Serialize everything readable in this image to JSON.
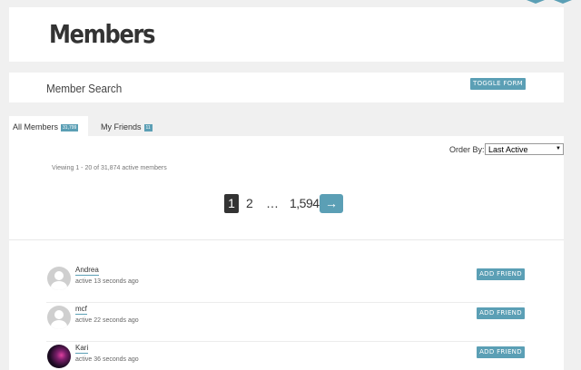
{
  "colors": {
    "accent": "#5b9fb5",
    "page_bg": "#f0f0f0",
    "card_bg": "#ffffff",
    "current_page_bg": "#333333"
  },
  "header": {
    "title": "Members"
  },
  "member_search": {
    "title": "Member Search",
    "toggle_label": "TOGGLE FORM"
  },
  "tabs": [
    {
      "label": "All Members",
      "count": "31,799"
    },
    {
      "label": "My Friends",
      "count": "11"
    }
  ],
  "order_by": {
    "label": "Order By:",
    "selected": "Last Active"
  },
  "viewing": "Viewing 1 - 20 of 31,874 active members",
  "pagination": {
    "current": "1",
    "next_page": "2",
    "ellipsis": "…",
    "last": "1,594",
    "next_arrow": "→"
  },
  "members": [
    {
      "name": "Andrea",
      "active": "active 13 seconds ago",
      "button": "ADD FRIEND",
      "avatar": "default-avatar-icon"
    },
    {
      "name": "mcf",
      "active": "active 22 seconds ago",
      "button": "ADD FRIEND",
      "avatar": "default-avatar-icon"
    },
    {
      "name": "Kari",
      "active": "active 36 seconds ago",
      "button": "ADD FRIEND",
      "avatar": "photo-avatar"
    }
  ]
}
